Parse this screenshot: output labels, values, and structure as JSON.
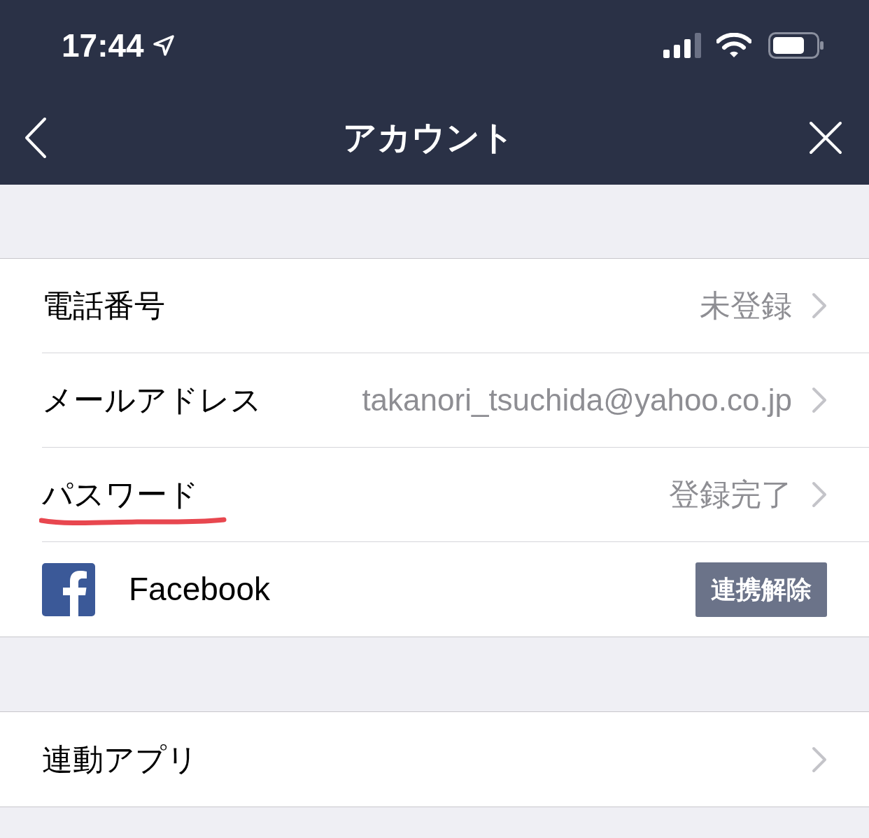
{
  "status_bar": {
    "time": "17:44"
  },
  "nav": {
    "title": "アカウント"
  },
  "sections": [
    {
      "rows": [
        {
          "kind": "value",
          "label": "電話番号",
          "value": "未登録",
          "underlined": false
        },
        {
          "kind": "value",
          "label": "メールアドレス",
          "value": "takanori_tsuchida@yahoo.co.jp",
          "underlined": false
        },
        {
          "kind": "value",
          "label": "パスワード",
          "value": "登録完了",
          "underlined": true
        },
        {
          "kind": "account",
          "label": "Facebook",
          "button": "連携解除"
        }
      ]
    },
    {
      "rows": [
        {
          "kind": "value",
          "label": "連動アプリ",
          "underlined": false
        }
      ]
    }
  ]
}
